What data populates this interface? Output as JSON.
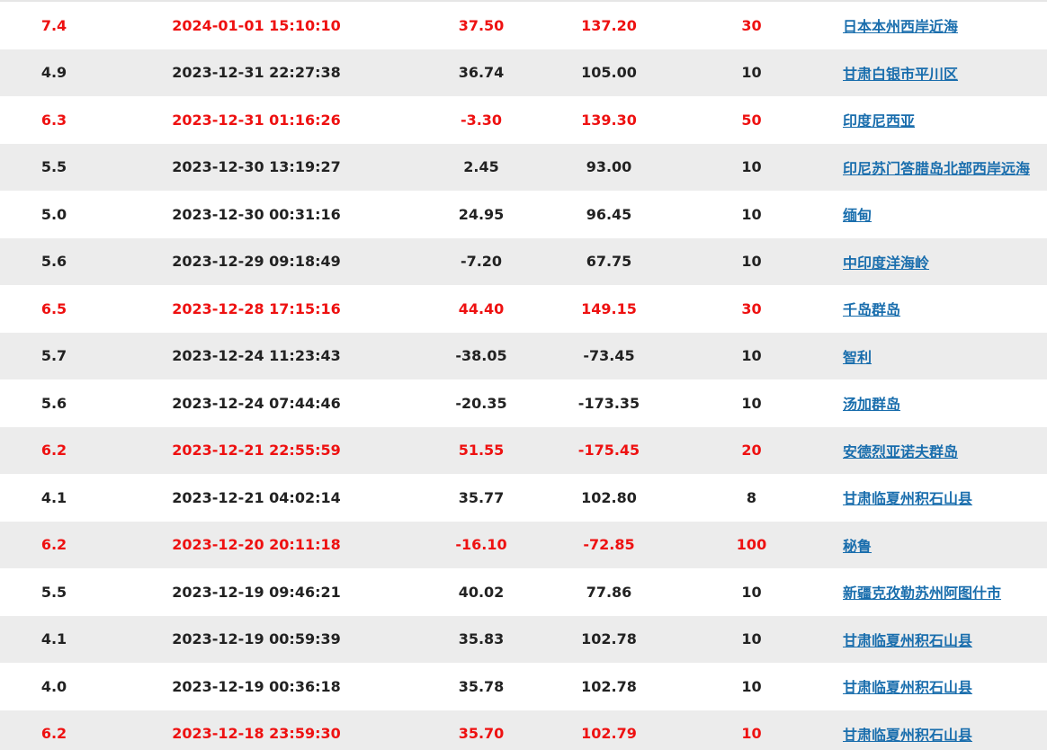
{
  "quakes": [
    {
      "mag": "7.4",
      "time": "2024-01-01 15:10:10",
      "lat": "37.50",
      "lon": "137.20",
      "depth": "30",
      "location": "日本本州西岸近海",
      "strong": true
    },
    {
      "mag": "4.9",
      "time": "2023-12-31 22:27:38",
      "lat": "36.74",
      "lon": "105.00",
      "depth": "10",
      "location": "甘肃白银市平川区",
      "strong": false
    },
    {
      "mag": "6.3",
      "time": "2023-12-31 01:16:26",
      "lat": "-3.30",
      "lon": "139.30",
      "depth": "50",
      "location": "印度尼西亚",
      "strong": true
    },
    {
      "mag": "5.5",
      "time": "2023-12-30 13:19:27",
      "lat": "2.45",
      "lon": "93.00",
      "depth": "10",
      "location": "印尼苏门答腊岛北部西岸远海",
      "strong": false
    },
    {
      "mag": "5.0",
      "time": "2023-12-30 00:31:16",
      "lat": "24.95",
      "lon": "96.45",
      "depth": "10",
      "location": "缅甸",
      "strong": false
    },
    {
      "mag": "5.6",
      "time": "2023-12-29 09:18:49",
      "lat": "-7.20",
      "lon": "67.75",
      "depth": "10",
      "location": "中印度洋海岭",
      "strong": false
    },
    {
      "mag": "6.5",
      "time": "2023-12-28 17:15:16",
      "lat": "44.40",
      "lon": "149.15",
      "depth": "30",
      "location": "千岛群岛",
      "strong": true
    },
    {
      "mag": "5.7",
      "time": "2023-12-24 11:23:43",
      "lat": "-38.05",
      "lon": "-73.45",
      "depth": "10",
      "location": "智利",
      "strong": false
    },
    {
      "mag": "5.6",
      "time": "2023-12-24 07:44:46",
      "lat": "-20.35",
      "lon": "-173.35",
      "depth": "10",
      "location": "汤加群岛",
      "strong": false
    },
    {
      "mag": "6.2",
      "time": "2023-12-21 22:55:59",
      "lat": "51.55",
      "lon": "-175.45",
      "depth": "20",
      "location": "安德烈亚诺夫群岛",
      "strong": true
    },
    {
      "mag": "4.1",
      "time": "2023-12-21 04:02:14",
      "lat": "35.77",
      "lon": "102.80",
      "depth": "8",
      "location": "甘肃临夏州积石山县",
      "strong": false
    },
    {
      "mag": "6.2",
      "time": "2023-12-20 20:11:18",
      "lat": "-16.10",
      "lon": "-72.85",
      "depth": "100",
      "location": "秘鲁",
      "strong": true
    },
    {
      "mag": "5.5",
      "time": "2023-12-19 09:46:21",
      "lat": "40.02",
      "lon": "77.86",
      "depth": "10",
      "location": "新疆克孜勒苏州阿图什市",
      "strong": false
    },
    {
      "mag": "4.1",
      "time": "2023-12-19 00:59:39",
      "lat": "35.83",
      "lon": "102.78",
      "depth": "10",
      "location": "甘肃临夏州积石山县",
      "strong": false
    },
    {
      "mag": "4.0",
      "time": "2023-12-19 00:36:18",
      "lat": "35.78",
      "lon": "102.78",
      "depth": "10",
      "location": "甘肃临夏州积石山县",
      "strong": false
    },
    {
      "mag": "6.2",
      "time": "2023-12-18 23:59:30",
      "lat": "35.70",
      "lon": "102.79",
      "depth": "10",
      "location": "甘肃临夏州积石山县",
      "strong": true
    }
  ],
  "colors": {
    "strong_text": "#ee1111",
    "normal_text": "#222222",
    "link": "#1a6ead",
    "stripe": "#ececec"
  }
}
